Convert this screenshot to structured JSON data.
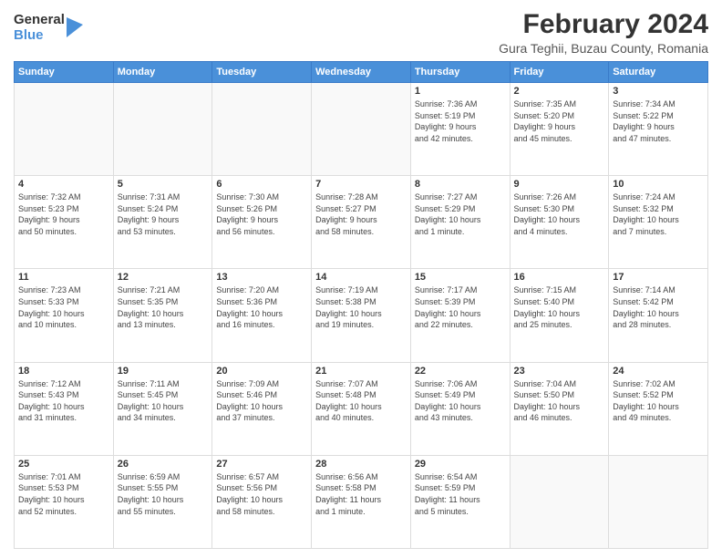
{
  "logo": {
    "general": "General",
    "blue": "Blue"
  },
  "title": "February 2024",
  "subtitle": "Gura Teghii, Buzau County, Romania",
  "days_of_week": [
    "Sunday",
    "Monday",
    "Tuesday",
    "Wednesday",
    "Thursday",
    "Friday",
    "Saturday"
  ],
  "weeks": [
    [
      {
        "day": "",
        "info": ""
      },
      {
        "day": "",
        "info": ""
      },
      {
        "day": "",
        "info": ""
      },
      {
        "day": "",
        "info": ""
      },
      {
        "day": "1",
        "info": "Sunrise: 7:36 AM\nSunset: 5:19 PM\nDaylight: 9 hours\nand 42 minutes."
      },
      {
        "day": "2",
        "info": "Sunrise: 7:35 AM\nSunset: 5:20 PM\nDaylight: 9 hours\nand 45 minutes."
      },
      {
        "day": "3",
        "info": "Sunrise: 7:34 AM\nSunset: 5:22 PM\nDaylight: 9 hours\nand 47 minutes."
      }
    ],
    [
      {
        "day": "4",
        "info": "Sunrise: 7:32 AM\nSunset: 5:23 PM\nDaylight: 9 hours\nand 50 minutes."
      },
      {
        "day": "5",
        "info": "Sunrise: 7:31 AM\nSunset: 5:24 PM\nDaylight: 9 hours\nand 53 minutes."
      },
      {
        "day": "6",
        "info": "Sunrise: 7:30 AM\nSunset: 5:26 PM\nDaylight: 9 hours\nand 56 minutes."
      },
      {
        "day": "7",
        "info": "Sunrise: 7:28 AM\nSunset: 5:27 PM\nDaylight: 9 hours\nand 58 minutes."
      },
      {
        "day": "8",
        "info": "Sunrise: 7:27 AM\nSunset: 5:29 PM\nDaylight: 10 hours\nand 1 minute."
      },
      {
        "day": "9",
        "info": "Sunrise: 7:26 AM\nSunset: 5:30 PM\nDaylight: 10 hours\nand 4 minutes."
      },
      {
        "day": "10",
        "info": "Sunrise: 7:24 AM\nSunset: 5:32 PM\nDaylight: 10 hours\nand 7 minutes."
      }
    ],
    [
      {
        "day": "11",
        "info": "Sunrise: 7:23 AM\nSunset: 5:33 PM\nDaylight: 10 hours\nand 10 minutes."
      },
      {
        "day": "12",
        "info": "Sunrise: 7:21 AM\nSunset: 5:35 PM\nDaylight: 10 hours\nand 13 minutes."
      },
      {
        "day": "13",
        "info": "Sunrise: 7:20 AM\nSunset: 5:36 PM\nDaylight: 10 hours\nand 16 minutes."
      },
      {
        "day": "14",
        "info": "Sunrise: 7:19 AM\nSunset: 5:38 PM\nDaylight: 10 hours\nand 19 minutes."
      },
      {
        "day": "15",
        "info": "Sunrise: 7:17 AM\nSunset: 5:39 PM\nDaylight: 10 hours\nand 22 minutes."
      },
      {
        "day": "16",
        "info": "Sunrise: 7:15 AM\nSunset: 5:40 PM\nDaylight: 10 hours\nand 25 minutes."
      },
      {
        "day": "17",
        "info": "Sunrise: 7:14 AM\nSunset: 5:42 PM\nDaylight: 10 hours\nand 28 minutes."
      }
    ],
    [
      {
        "day": "18",
        "info": "Sunrise: 7:12 AM\nSunset: 5:43 PM\nDaylight: 10 hours\nand 31 minutes."
      },
      {
        "day": "19",
        "info": "Sunrise: 7:11 AM\nSunset: 5:45 PM\nDaylight: 10 hours\nand 34 minutes."
      },
      {
        "day": "20",
        "info": "Sunrise: 7:09 AM\nSunset: 5:46 PM\nDaylight: 10 hours\nand 37 minutes."
      },
      {
        "day": "21",
        "info": "Sunrise: 7:07 AM\nSunset: 5:48 PM\nDaylight: 10 hours\nand 40 minutes."
      },
      {
        "day": "22",
        "info": "Sunrise: 7:06 AM\nSunset: 5:49 PM\nDaylight: 10 hours\nand 43 minutes."
      },
      {
        "day": "23",
        "info": "Sunrise: 7:04 AM\nSunset: 5:50 PM\nDaylight: 10 hours\nand 46 minutes."
      },
      {
        "day": "24",
        "info": "Sunrise: 7:02 AM\nSunset: 5:52 PM\nDaylight: 10 hours\nand 49 minutes."
      }
    ],
    [
      {
        "day": "25",
        "info": "Sunrise: 7:01 AM\nSunset: 5:53 PM\nDaylight: 10 hours\nand 52 minutes."
      },
      {
        "day": "26",
        "info": "Sunrise: 6:59 AM\nSunset: 5:55 PM\nDaylight: 10 hours\nand 55 minutes."
      },
      {
        "day": "27",
        "info": "Sunrise: 6:57 AM\nSunset: 5:56 PM\nDaylight: 10 hours\nand 58 minutes."
      },
      {
        "day": "28",
        "info": "Sunrise: 6:56 AM\nSunset: 5:58 PM\nDaylight: 11 hours\nand 1 minute."
      },
      {
        "day": "29",
        "info": "Sunrise: 6:54 AM\nSunset: 5:59 PM\nDaylight: 11 hours\nand 5 minutes."
      },
      {
        "day": "",
        "info": ""
      },
      {
        "day": "",
        "info": ""
      }
    ]
  ]
}
